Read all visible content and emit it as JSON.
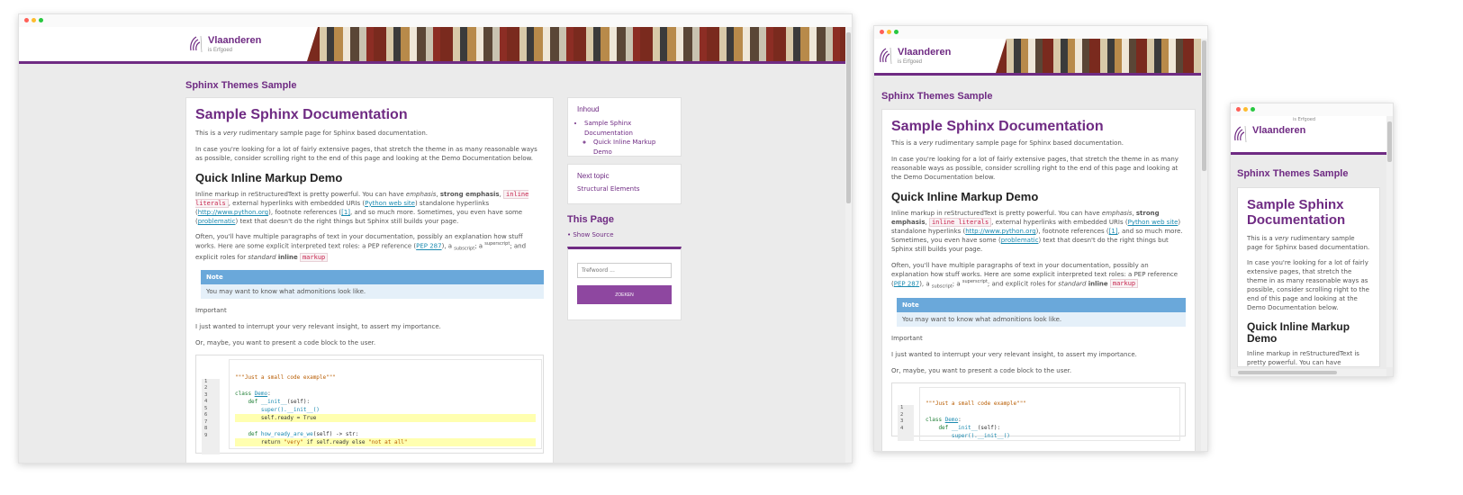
{
  "header": {
    "brand_name": "Vlaanderen",
    "brand_sub": "is Erfgoed"
  },
  "site_title": "Sphinx Themes Sample",
  "page": {
    "h1": "Sample Sphinx Documentation",
    "intro_a": "This is a ",
    "intro_em": "very",
    "intro_b": " rudimentary sample page for Sphinx based documentation.",
    "para2": "In case you're looking for a lot of fairly extensive pages, that stretch the theme in as many reasonable ways as possible, consider scrolling right to the end of this page and looking at the Demo Documentation below.",
    "h2": "Quick Inline Markup Demo",
    "p3_a": "Inline markup in reStructuredText is pretty powerful. You can have ",
    "p3_em": "emphasis",
    "p3_strong": "strong emphasis",
    "p3_code": "inline literals",
    "p3_b": ", external hyperlinks with embedded URIs (",
    "p3_link1": "Python web site",
    "p3_c": ") standalone hyperlinks (",
    "p3_link2": "http://www.python.org",
    "p3_d": "), footnote references (",
    "p3_fn": "[1]",
    "p3_e": ", and so much more. Sometimes, you even have some (",
    "p3_link3": "problematic",
    "p3_f": ") text that doesn't do the right things but Sphinx still builds your page.",
    "p4_a": "Often, you'll have multiple paragraphs of text in your documentation, possibly an explanation how stuff works. Here are some explicit interpreted text roles: a PEP reference (",
    "p4_pep": "PEP 287",
    "p4_b": "), a ",
    "p4_sub": "subscript",
    "p4_c": "; a ",
    "p4_sup": "superscript",
    "p4_d": "; and explicit roles for ",
    "p4_em": "standard",
    "p4_strong": "inline",
    "p4_code": "markup",
    "note_title": "Note",
    "note_body": "You may want to know what admonitions look like.",
    "important": "Important",
    "p5": "I just wanted to interrupt your very relevant insight, to assert my importance.",
    "p6": "Or, maybe, you want to present a code block to the user."
  },
  "code": {
    "line_numbers": [
      "1",
      "2",
      "3",
      "4",
      "5",
      "6",
      "7",
      "8",
      "9"
    ],
    "doc": "\"\"\"Just a small code example\"\"\"",
    "l2_kw": "class ",
    "l2_name": "Demo",
    "l2_end": ":",
    "l3_kw": "    def ",
    "l3_name": "__init__",
    "l3_arg": "(self):",
    "l4": "        super().__init__()",
    "l5": "        self.ready = True",
    "l7_kw": "    def ",
    "l7_name": "how_ready_are_we",
    "l7_rest": "(self) -> str:",
    "l8_a": "        return ",
    "l8_s1": "\"very\"",
    "l8_b": " if self.ready else ",
    "l8_s2": "\"not at all\""
  },
  "sidebar": {
    "toc_title": "Inhoud",
    "toc_item": "Sample Sphinx Documentation",
    "toc_sub": "Quick Inline Markup Demo",
    "next_title": "Next topic",
    "next_link": "Structural Elements",
    "this_page": "This Page",
    "show_source": "Show Source",
    "search_placeholder": "Trefwoord ...",
    "search_button": "ZOEKEN"
  },
  "colors": {
    "brand": "#6f2b83",
    "button": "#8e47a0",
    "note": "#6aa8da"
  }
}
